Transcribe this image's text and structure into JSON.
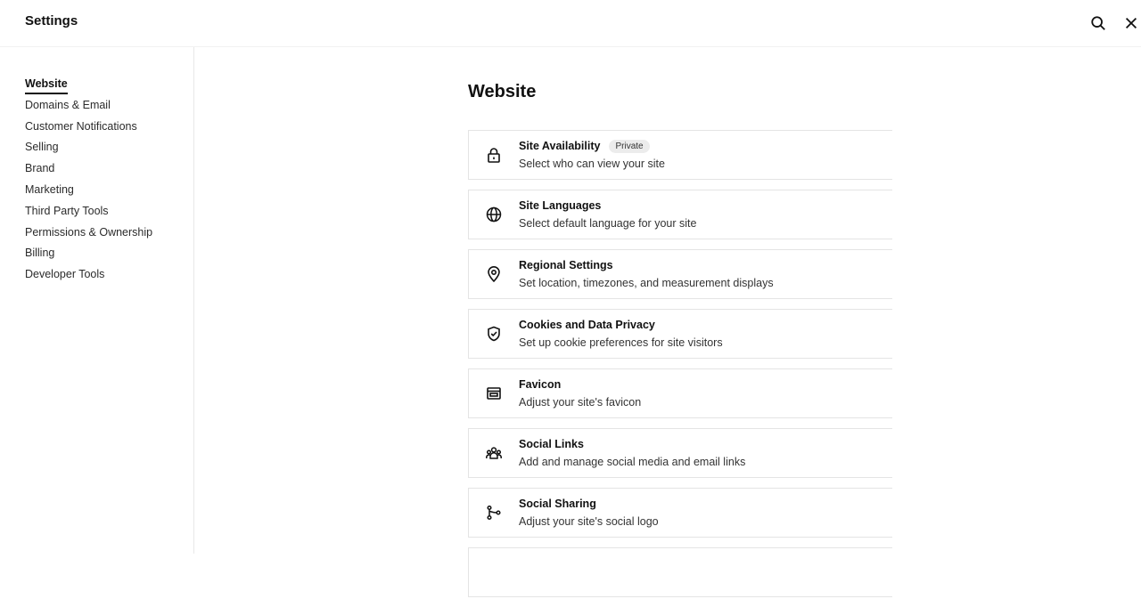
{
  "header": {
    "title": "Settings"
  },
  "sidebar": {
    "items": [
      {
        "label": "Website",
        "active": true
      },
      {
        "label": "Domains & Email"
      },
      {
        "label": "Customer Notifications"
      },
      {
        "label": "Selling"
      },
      {
        "label": "Brand"
      },
      {
        "label": "Marketing"
      },
      {
        "label": "Third Party Tools"
      },
      {
        "label": "Permissions & Ownership"
      },
      {
        "label": "Billing"
      },
      {
        "label": "Developer Tools"
      }
    ]
  },
  "main": {
    "title": "Website",
    "cards": [
      {
        "title": "Site Availability",
        "badge": "Private",
        "desc": "Select who can view your site",
        "icon": "lock-icon"
      },
      {
        "title": "Site Languages",
        "desc": "Select default language for your site",
        "icon": "globe-icon"
      },
      {
        "title": "Regional Settings",
        "desc": "Set location, timezones, and measurement displays",
        "icon": "map-pin-icon"
      },
      {
        "title": "Cookies and Data Privacy",
        "desc": "Set up cookie preferences for site visitors",
        "icon": "shield-check-icon"
      },
      {
        "title": "Favicon",
        "desc": "Adjust your site's favicon",
        "icon": "browser-window-icon"
      },
      {
        "title": "Social Links",
        "desc": "Add and manage social media and email links",
        "icon": "people-icon"
      },
      {
        "title": "Social Sharing",
        "desc": "Adjust your site's social logo",
        "icon": "share-branch-icon"
      }
    ]
  }
}
